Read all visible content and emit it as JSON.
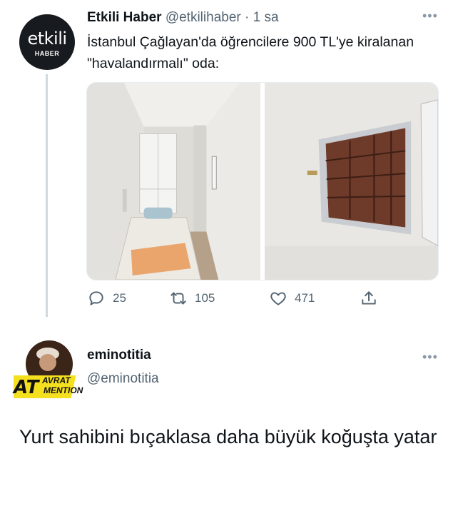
{
  "tweet": {
    "avatar": {
      "brand": "etkili",
      "sub": "HABER"
    },
    "display_name": "Etkili Haber",
    "handle": "@etkilihaber",
    "separator": "·",
    "time": "1 sa",
    "more_label": "•••",
    "text": "İstanbul Çağlayan'da öğrencilere 900 TL'ye kiralanan \"havalandırmalı\" oda:",
    "media": [
      {
        "icon": "room-photo"
      },
      {
        "icon": "window-photo"
      }
    ],
    "actions": {
      "reply_count": "25",
      "retweet_count": "105",
      "like_count": "471"
    }
  },
  "reply": {
    "avatar": {
      "line1": "AVRAT",
      "line2": "MENTION",
      "mark": "AT"
    },
    "display_name": "eminotitia",
    "handle": "@eminotitia",
    "more_label": "•••",
    "text": "Yurt sahibini bıçaklasa daha büyük koğuşta yatar"
  },
  "colors": {
    "text": "#0f1419",
    "secondary": "#536471",
    "line": "#cfd9de"
  }
}
